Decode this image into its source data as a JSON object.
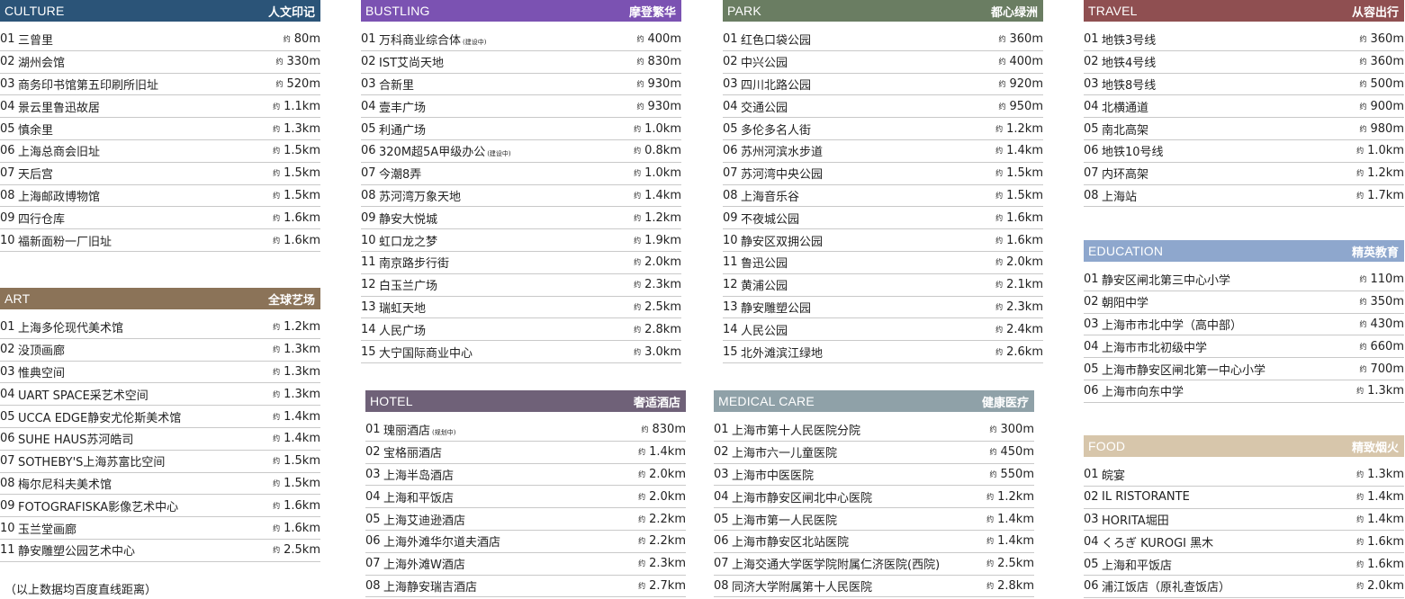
{
  "approx_label": "约",
  "note": "（以上数据均百度直线距离）",
  "sections": {
    "culture": {
      "en": "CULTURE",
      "zh": "人文印记",
      "color": "#2b5478",
      "items": [
        {
          "num": "01",
          "name": "三曾里",
          "tag": "",
          "dist": "80m"
        },
        {
          "num": "02",
          "name": "湖州会馆",
          "tag": "",
          "dist": "330m"
        },
        {
          "num": "03",
          "name": "商务印书馆第五印刷所旧址",
          "tag": "",
          "dist": "520m"
        },
        {
          "num": "04",
          "name": "景云里鲁迅故居",
          "tag": "",
          "dist": "1.1km"
        },
        {
          "num": "05",
          "name": "慎余里",
          "tag": "",
          "dist": "1.3km"
        },
        {
          "num": "06",
          "name": "上海总商会旧址",
          "tag": "",
          "dist": "1.5km"
        },
        {
          "num": "07",
          "name": "天后宫",
          "tag": "",
          "dist": "1.5km"
        },
        {
          "num": "08",
          "name": "上海邮政博物馆",
          "tag": "",
          "dist": "1.5km"
        },
        {
          "num": "09",
          "name": "四行仓库",
          "tag": "",
          "dist": "1.6km"
        },
        {
          "num": "10",
          "name": "福新面粉一厂旧址",
          "tag": "",
          "dist": "1.6km"
        }
      ]
    },
    "art": {
      "en": "ART",
      "zh": "全球艺场",
      "color": "#8b7358",
      "items": [
        {
          "num": "01",
          "name": "上海多伦现代美术馆",
          "tag": "",
          "dist": "1.2km"
        },
        {
          "num": "02",
          "name": "没顶画廊",
          "tag": "",
          "dist": "1.3km"
        },
        {
          "num": "03",
          "name": "惟典空间",
          "tag": "",
          "dist": "1.3km"
        },
        {
          "num": "04",
          "name": "UART SPACE采艺术空间",
          "tag": "",
          "dist": "1.3km"
        },
        {
          "num": "05",
          "name": "UCCA EDGE静安尤伦斯美术馆",
          "tag": "",
          "dist": "1.4km"
        },
        {
          "num": "06",
          "name": "SUHE HAUS苏河皓司",
          "tag": "",
          "dist": "1.4km"
        },
        {
          "num": "07",
          "name": "SOTHEBY'S上海苏富比空间",
          "tag": "",
          "dist": "1.5km"
        },
        {
          "num": "08",
          "name": "梅尔尼科夫美术馆",
          "tag": "",
          "dist": "1.5km"
        },
        {
          "num": "09",
          "name": "FOTOGRAFISKA影像艺术中心",
          "tag": "",
          "dist": "1.6km"
        },
        {
          "num": "10",
          "name": "玉兰堂画廊",
          "tag": "",
          "dist": "1.6km"
        },
        {
          "num": "11",
          "name": "静安雕塑公园艺术中心",
          "tag": "",
          "dist": "2.5km"
        }
      ]
    },
    "bustling": {
      "en": "BUSTLING",
      "zh": "摩登繁华",
      "color": "#7b52b2",
      "items": [
        {
          "num": "01",
          "name": "万科商业综合体",
          "tag": "(建设中)",
          "dist": "400m"
        },
        {
          "num": "02",
          "name": "IST艾尚天地",
          "tag": "",
          "dist": "830m"
        },
        {
          "num": "03",
          "name": "合新里",
          "tag": "",
          "dist": "930m"
        },
        {
          "num": "04",
          "name": "壹丰广场",
          "tag": "",
          "dist": "930m"
        },
        {
          "num": "05",
          "name": "利通广场",
          "tag": "",
          "dist": "1.0km"
        },
        {
          "num": "06",
          "name": "320M超5A甲级办公",
          "tag": "(建设中)",
          "dist": "0.8km"
        },
        {
          "num": "07",
          "name": "今潮8弄",
          "tag": "",
          "dist": "1.0km"
        },
        {
          "num": "08",
          "name": "苏河湾万象天地",
          "tag": "",
          "dist": "1.4km"
        },
        {
          "num": "09",
          "name": "静安大悦城",
          "tag": "",
          "dist": "1.2km"
        },
        {
          "num": "10",
          "name": "虹口龙之梦",
          "tag": "",
          "dist": "1.9km"
        },
        {
          "num": "11",
          "name": "南京路步行街",
          "tag": "",
          "dist": "2.0km"
        },
        {
          "num": "12",
          "name": "白玉兰广场",
          "tag": "",
          "dist": "2.3km"
        },
        {
          "num": "13",
          "name": "瑞虹天地",
          "tag": "",
          "dist": "2.5km"
        },
        {
          "num": "14",
          "name": "人民广场",
          "tag": "",
          "dist": "2.8km"
        },
        {
          "num": "15",
          "name": "大宁国际商业中心",
          "tag": "",
          "dist": "3.0km"
        }
      ]
    },
    "hotel": {
      "en": "HOTEL",
      "zh": "奢适酒店",
      "color": "#6f6178",
      "items": [
        {
          "num": "01",
          "name": "瑰丽酒店",
          "tag": "(规划中)",
          "dist": "830m"
        },
        {
          "num": "02",
          "name": "宝格丽酒店",
          "tag": "",
          "dist": "1.4km"
        },
        {
          "num": "03",
          "name": "上海半岛酒店",
          "tag": "",
          "dist": "2.0km"
        },
        {
          "num": "04",
          "name": "上海和平饭店",
          "tag": "",
          "dist": "2.0km"
        },
        {
          "num": "05",
          "name": "上海艾迪逊酒店",
          "tag": "",
          "dist": "2.2km"
        },
        {
          "num": "06",
          "name": "上海外滩华尔道夫酒店",
          "tag": "",
          "dist": "2.2km"
        },
        {
          "num": "07",
          "name": "上海外滩W酒店",
          "tag": "",
          "dist": "2.3km"
        },
        {
          "num": "08",
          "name": "上海静安瑞吉酒店",
          "tag": "",
          "dist": "2.7km"
        }
      ]
    },
    "park": {
      "en": "PARK",
      "zh": "都心绿洲",
      "color": "#6a7d62",
      "items": [
        {
          "num": "01",
          "name": "红色口袋公园",
          "tag": "",
          "dist": "360m"
        },
        {
          "num": "02",
          "name": "中兴公园",
          "tag": "",
          "dist": "400m"
        },
        {
          "num": "03",
          "name": "四川北路公园",
          "tag": "",
          "dist": "920m"
        },
        {
          "num": "04",
          "name": "交通公园",
          "tag": "",
          "dist": "950m"
        },
        {
          "num": "05",
          "name": "多伦多名人街",
          "tag": "",
          "dist": "1.2km"
        },
        {
          "num": "06",
          "name": "苏州河滨水步道",
          "tag": "",
          "dist": "1.4km"
        },
        {
          "num": "07",
          "name": "苏河湾中央公园",
          "tag": "",
          "dist": "1.5km"
        },
        {
          "num": "08",
          "name": "上海音乐谷",
          "tag": "",
          "dist": "1.5km"
        },
        {
          "num": "09",
          "name": "不夜城公园",
          "tag": "",
          "dist": "1.6km"
        },
        {
          "num": "10",
          "name": "静安区双拥公园",
          "tag": "",
          "dist": "1.6km"
        },
        {
          "num": "11",
          "name": "鲁迅公园",
          "tag": "",
          "dist": "2.0km"
        },
        {
          "num": "12",
          "name": "黄浦公园",
          "tag": "",
          "dist": "2.1km"
        },
        {
          "num": "13",
          "name": "静安雕塑公园",
          "tag": "",
          "dist": "2.3km"
        },
        {
          "num": "14",
          "name": "人民公园",
          "tag": "",
          "dist": "2.4km"
        },
        {
          "num": "15",
          "name": "北外滩滨江绿地",
          "tag": "",
          "dist": "2.6km"
        }
      ]
    },
    "medical": {
      "en": "MEDICAL CARE",
      "zh": "健康医疗",
      "color": "#8fa1a8",
      "items": [
        {
          "num": "01",
          "name": "上海市第十人民医院分院",
          "tag": "",
          "dist": "300m"
        },
        {
          "num": "02",
          "name": "上海市六一儿童医院",
          "tag": "",
          "dist": "450m"
        },
        {
          "num": "03",
          "name": "上海市中医医院",
          "tag": "",
          "dist": "550m"
        },
        {
          "num": "04",
          "name": "上海市静安区闸北中心医院",
          "tag": "",
          "dist": "1.2km"
        },
        {
          "num": "05",
          "name": "上海市第一人民医院",
          "tag": "",
          "dist": "1.4km"
        },
        {
          "num": "06",
          "name": "上海市静安区北站医院",
          "tag": "",
          "dist": "1.4km"
        },
        {
          "num": "07",
          "name": "上海交通大学医学院附属仁济医院(西院)",
          "tag": "",
          "dist": "2.5km"
        },
        {
          "num": "08",
          "name": "同济大学附属第十人民医院",
          "tag": "",
          "dist": "2.8km"
        }
      ]
    },
    "travel": {
      "en": "TRAVEL",
      "zh": "从容出行",
      "color": "#8f4f51",
      "items": [
        {
          "num": "01",
          "name": "地铁3号线",
          "tag": "",
          "dist": "360m"
        },
        {
          "num": "02",
          "name": "地铁4号线",
          "tag": "",
          "dist": "360m"
        },
        {
          "num": "03",
          "name": "地铁8号线",
          "tag": "",
          "dist": "500m"
        },
        {
          "num": "04",
          "name": "北横通道",
          "tag": "",
          "dist": "900m"
        },
        {
          "num": "05",
          "name": "南北高架",
          "tag": "",
          "dist": "980m"
        },
        {
          "num": "06",
          "name": "地铁10号线",
          "tag": "",
          "dist": "1.0km"
        },
        {
          "num": "07",
          "name": "内环高架",
          "tag": "",
          "dist": "1.2km"
        },
        {
          "num": "08",
          "name": "上海站",
          "tag": "",
          "dist": "1.7km"
        }
      ]
    },
    "education": {
      "en": "EDUCATION",
      "zh": "精英教育",
      "color": "#8ea7cd",
      "items": [
        {
          "num": "01",
          "name": "静安区闸北第三中心小学",
          "tag": "",
          "dist": "110m"
        },
        {
          "num": "02",
          "name": "朝阳中学",
          "tag": "",
          "dist": "350m"
        },
        {
          "num": "03",
          "name": "上海市市北中学（高中部）",
          "tag": "",
          "dist": "430m"
        },
        {
          "num": "04",
          "name": "上海市市北初级中学",
          "tag": "",
          "dist": "660m"
        },
        {
          "num": "05",
          "name": "上海市静安区闸北第一中心小学",
          "tag": "",
          "dist": "700m"
        },
        {
          "num": "06",
          "name": "上海市向东中学",
          "tag": "",
          "dist": "1.3km"
        }
      ]
    },
    "food": {
      "en": "FOOD",
      "zh": "精致烟火",
      "color": "#d7c6ab",
      "items": [
        {
          "num": "01",
          "name": "皖宴",
          "tag": "",
          "dist": "1.3km"
        },
        {
          "num": "02",
          "name": "IL RISTORANTE",
          "tag": "",
          "dist": "1.4km"
        },
        {
          "num": "03",
          "name": "HORITA堀田",
          "tag": "",
          "dist": "1.4km"
        },
        {
          "num": "04",
          "name": "くろぎ KUROGI 黑木",
          "tag": "",
          "dist": "1.6km"
        },
        {
          "num": "05",
          "name": "上海和平饭店",
          "tag": "",
          "dist": "1.6km"
        },
        {
          "num": "06",
          "name": "浦江饭店（原礼查饭店）",
          "tag": "",
          "dist": "2.0km"
        }
      ]
    }
  }
}
